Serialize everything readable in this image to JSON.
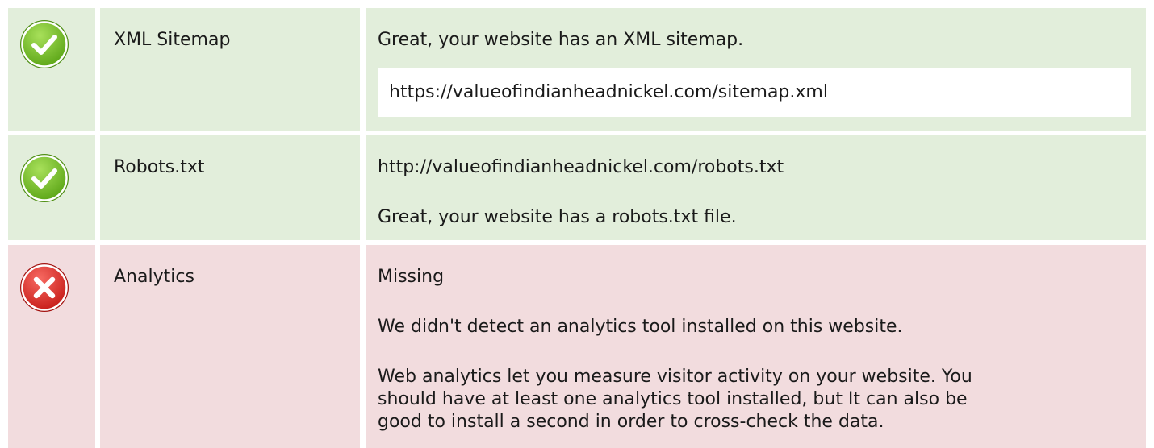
{
  "rows": [
    {
      "status": "pass",
      "icon": "check-icon",
      "name": "XML Sitemap",
      "message": "Great, your website has an XML sitemap.",
      "url": "https://valueofindianheadnickel.com/sitemap.xml"
    },
    {
      "status": "pass",
      "icon": "check-icon",
      "name": "Robots.txt",
      "url": "http://valueofindianheadnickel.com/robots.txt",
      "message": "Great, your website has a robots.txt file."
    },
    {
      "status": "fail",
      "icon": "cross-icon",
      "name": "Analytics",
      "value": "Missing",
      "message": "We didn't detect an analytics tool installed on this website.",
      "advice_lines": [
        "Web analytics let you measure visitor activity on your website. You",
        "should have at least one analytics tool installed, but It can also be",
        "good to install a second in order to cross-check the data."
      ]
    }
  ],
  "colors": {
    "pass_bg": "#e2eedb",
    "fail_bg": "#f2dcde",
    "pass_icon": "#7cc522",
    "fail_icon": "#e83a36"
  }
}
